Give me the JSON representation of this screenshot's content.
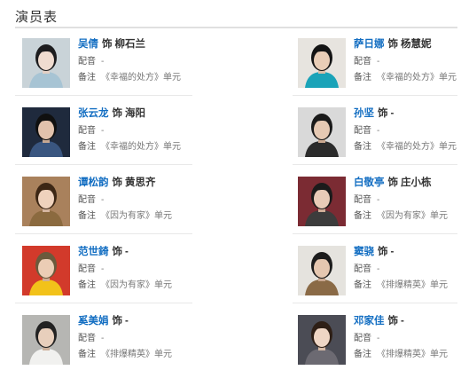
{
  "section_title": "演员表",
  "cast": [
    {
      "actor": "吴倩",
      "role_prefix": "饰",
      "role": "柳石兰",
      "dub_label": "配音",
      "dub": "-",
      "note_label": "备注",
      "note": "《幸福的处方》单元",
      "bg": "#c9d3d8",
      "shirt": "#a7c4d4",
      "hair": "#1d1d1f",
      "skin": "#f0dcd0",
      "shade": "#e2cfc4",
      "avatar_icon": "portrait-photo"
    },
    {
      "actor": "萨日娜",
      "role_prefix": "饰",
      "role": "杨慧妮",
      "dub_label": "配音",
      "dub": "-",
      "note_label": "备注",
      "note": "《幸福的处方》单元",
      "bg": "#e7e4df",
      "shirt": "#1aa3b8",
      "hair": "#141414",
      "skin": "#e9cdb6",
      "shade": "#d9bda6",
      "avatar_icon": "portrait-photo"
    },
    {
      "actor": "张云龙",
      "role_prefix": "饰",
      "role": "海阳",
      "dub_label": "配音",
      "dub": "-",
      "note_label": "备注",
      "note": "《幸福的处方》单元",
      "bg": "#1f2a3d",
      "shirt": "#3a5680",
      "hair": "#101010",
      "skin": "#e1c2ad",
      "shade": "#c7a893",
      "avatar_icon": "portrait-photo"
    },
    {
      "actor": "孙坚",
      "role_prefix": "饰",
      "role": "-",
      "dub_label": "配音",
      "dub": "-",
      "note_label": "备注",
      "note": "《幸福的处方》单元",
      "bg": "#d9d9d9",
      "shirt": "#2b2b2b",
      "hair": "#1a1a1a",
      "skin": "#e6c9b3",
      "shade": "#caa890",
      "avatar_icon": "portrait-photo"
    },
    {
      "actor": "谭松韵",
      "role_prefix": "饰",
      "role": "黄思齐",
      "dub_label": "配音",
      "dub": "-",
      "note_label": "备注",
      "note": "《因为有家》单元",
      "bg": "#a9815c",
      "shirt": "#8b6a3f",
      "hair": "#3d2715",
      "skin": "#efd2bd",
      "shade": "#d5b59f",
      "avatar_icon": "portrait-photo"
    },
    {
      "actor": "白敬亭",
      "role_prefix": "饰",
      "role": "庄小栋",
      "dub_label": "配音",
      "dub": "-",
      "note_label": "备注",
      "note": "《因为有家》单元",
      "bg": "#7b2b33",
      "shirt": "#3c3c3c",
      "hair": "#1b1b1b",
      "skin": "#e8cbb7",
      "shade": "#d0ae98",
      "avatar_icon": "portrait-photo"
    },
    {
      "actor": "范世錡",
      "role_prefix": "饰",
      "role": "-",
      "dub_label": "配音",
      "dub": "-",
      "note_label": "备注",
      "note": "《因为有家》单元",
      "bg": "#d23a2b",
      "shirt": "#f2c21a",
      "hair": "#6b5a3c",
      "skin": "#ebcdb5",
      "shade": "#cfae95",
      "avatar_icon": "portrait-photo"
    },
    {
      "actor": "窦骁",
      "role_prefix": "饰",
      "role": "-",
      "dub_label": "配音",
      "dub": "-",
      "note_label": "备注",
      "note": "《排爆精英》单元",
      "bg": "#e5e3de",
      "shirt": "#8a6a46",
      "hair": "#1c1c1c",
      "skin": "#e5c7b0",
      "shade": "#c9a78f",
      "avatar_icon": "portrait-photo"
    },
    {
      "actor": "奚美娟",
      "role_prefix": "饰",
      "role": "-",
      "dub_label": "配音",
      "dub": "-",
      "note_label": "备注",
      "note": "《排爆精英》单元",
      "bg": "#b6b6b3",
      "shirt": "#f1f1ef",
      "hair": "#222222",
      "skin": "#e8cfbc",
      "shade": "#ccb09b",
      "avatar_icon": "portrait-photo"
    },
    {
      "actor": "邓家佳",
      "role_prefix": "饰",
      "role": "-",
      "dub_label": "配音",
      "dub": "-",
      "note_label": "备注",
      "note": "《排爆精英》单元",
      "bg": "#4b4c55",
      "shirt": "#6c6a72",
      "hair": "#2e1f16",
      "skin": "#efd6c5",
      "shade": "#d7baa6",
      "avatar_icon": "portrait-photo"
    }
  ]
}
